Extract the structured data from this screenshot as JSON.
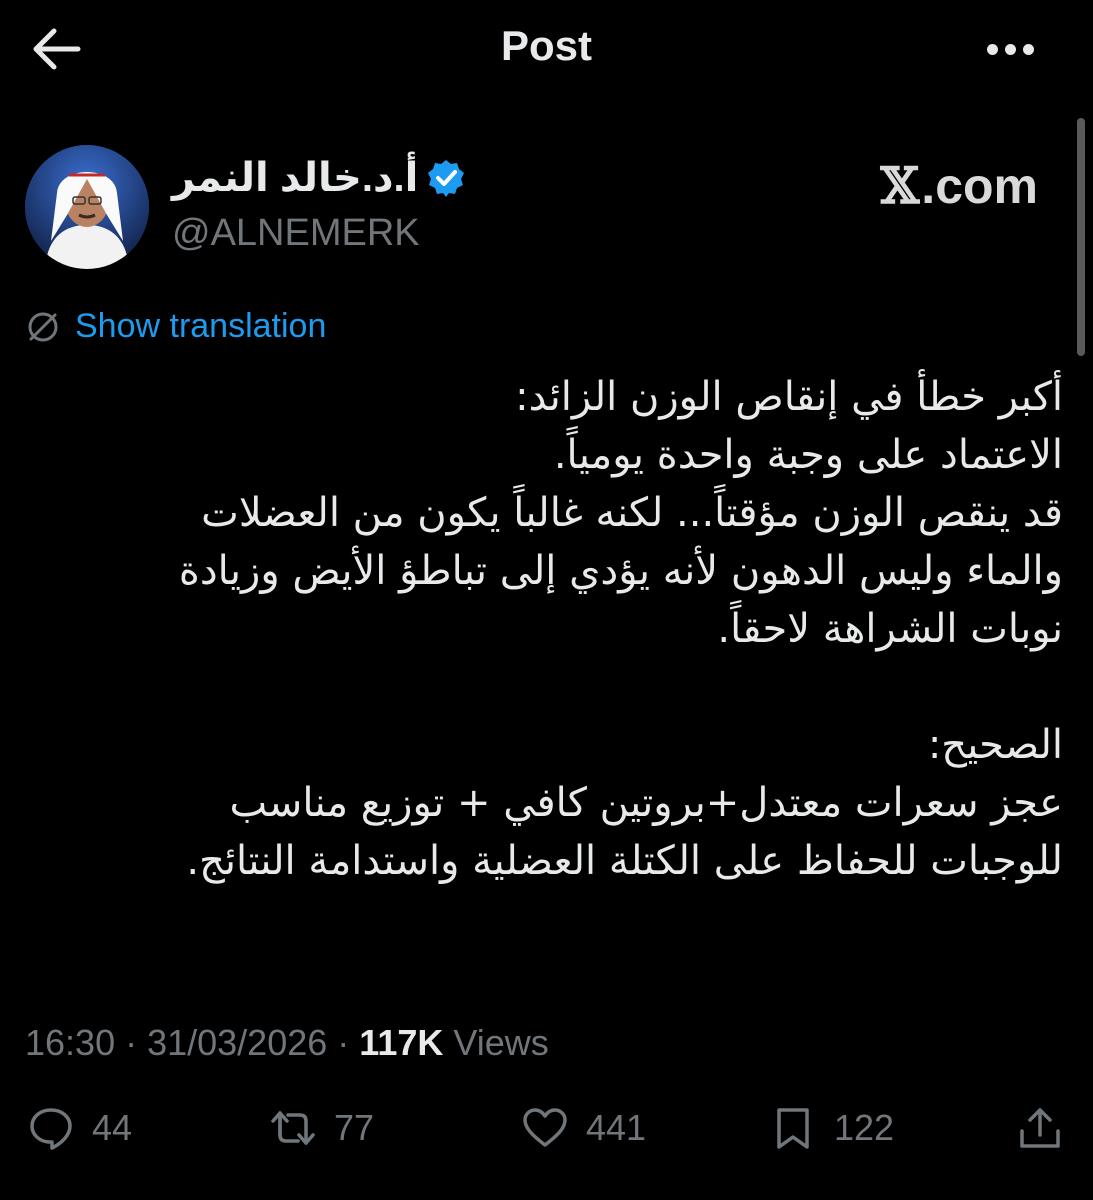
{
  "header": {
    "title": "Post",
    "back_icon": "arrow-left-icon",
    "more_icon": "more-horizontal-icon"
  },
  "author": {
    "display_name": "أ.د.خالد النمر",
    "handle": "@ALNEMERK",
    "verified_icon": "verified-badge-icon"
  },
  "watermark": {
    "x_glyph": "𝕏",
    "domain": ".com"
  },
  "translation": {
    "label": "Show translation",
    "icon": "globe-slash-icon"
  },
  "tweet": {
    "text": "أكبر خطأ في إنقاص الوزن الزائد:\nالاعتماد على وجبة واحدة يومياً.\nقد ينقص الوزن مؤقتاً... لكنه غالباً يكون من العضلات\nوالماء وليس الدهون لأنه يؤدي إلى تباطؤ الأيض وزيادة\nنوبات الشراهة لاحقاً.\n\nالصحيح:\n عجز سعرات معتدل+بروتين كافي + توزيع مناسب\nللوجبات للحفاظ على الكتلة العضلية واستدامة النتائج."
  },
  "meta": {
    "time": "16:30",
    "separator": " · ",
    "date": "31/03/2026",
    "views_count": "117K",
    "views_label": " Views"
  },
  "actions": {
    "replies": "44",
    "reposts": "77",
    "likes": "441",
    "bookmarks": "122"
  },
  "colors": {
    "background": "#000000",
    "text": "#e7e9ea",
    "muted": "#71767b",
    "accent": "#1d9bf0"
  }
}
